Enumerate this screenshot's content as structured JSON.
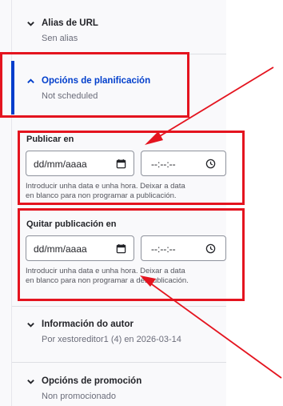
{
  "sections": {
    "url_alias": {
      "title": "Alias de URL",
      "subtitle": "Sen alias"
    },
    "scheduling": {
      "title": "Opcións de planificación",
      "subtitle": "Not scheduled"
    },
    "author": {
      "title": "Información do autor",
      "subtitle": "Por xestoreditor1 (4) en 2026-03-14"
    },
    "promotion": {
      "title": "Opcións de promoción",
      "subtitle": "Non promocionado"
    }
  },
  "publish_on": {
    "label": "Publicar en",
    "date_placeholder": "dd/mm/aaaa",
    "time_placeholder": "--:--:--",
    "help_line1": "Introducir unha data e unha hora. Deixar a data",
    "help_line2": "en blanco para non programar a publicación."
  },
  "unpublish_on": {
    "label": "Quitar publicación en",
    "date_placeholder": "dd/mm/aaaa",
    "time_placeholder": "--:--:--",
    "help_line1": "Introducir unha data e unha hora. Deixar a data",
    "help_line2": "en blanco para non programar a despublicación."
  },
  "colors": {
    "accent": "#003ecc",
    "highlight": "#e4141f"
  }
}
